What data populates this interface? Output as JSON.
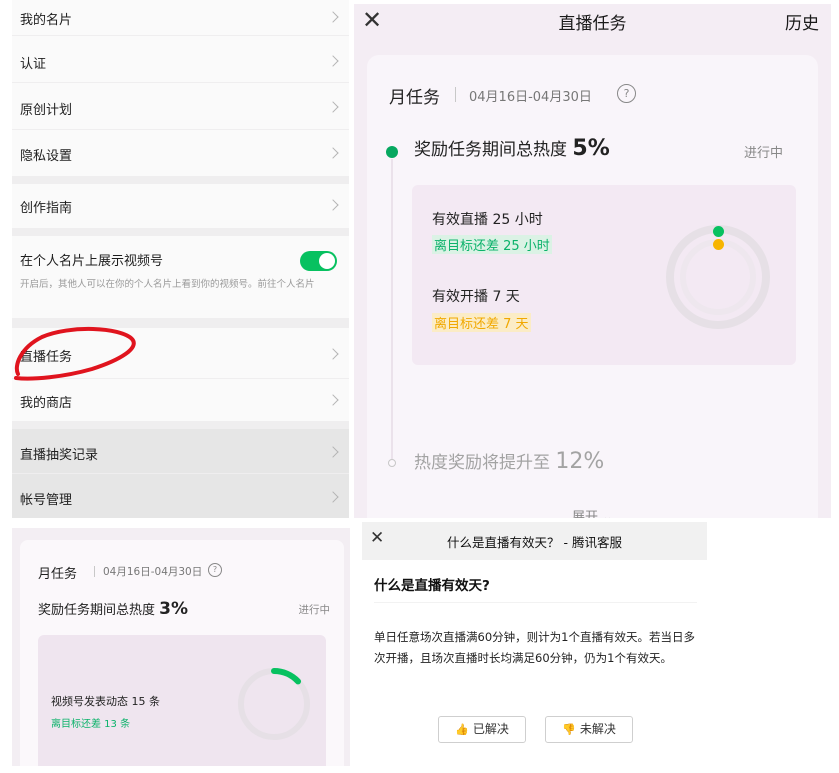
{
  "settings": {
    "items": [
      {
        "label": "我的名片"
      },
      {
        "label": "认证"
      },
      {
        "label": "原创计划"
      },
      {
        "label": "隐私设置"
      },
      {
        "label": "创作指南"
      },
      {
        "label": "在个人名片上展示视频号"
      },
      {
        "label": "直播任务"
      },
      {
        "label": "我的商店"
      },
      {
        "label": "直播抽奖记录"
      },
      {
        "label": "帐号管理"
      }
    ],
    "toggle_on": true,
    "toggle_hint": "开启后，其他人可以在你的个人名片上看到你的视频号。前往个人名片"
  },
  "live_task": {
    "title": "直播任务",
    "history": "历史",
    "monthly": "月任务",
    "date_range": "04月16日-04月30日",
    "help": "?",
    "reward_text": "奖励任务期间总热度",
    "reward_value": "5%",
    "status": "进行中",
    "tasks": [
      {
        "label": "有效直播 25 小时",
        "remain": "离目标还差 25 小时"
      },
      {
        "label": "有效开播 7 天",
        "remain": "离目标还差 7 天"
      }
    ],
    "next_text": "热度奖励将提升至",
    "next_value": "12%",
    "expand": "展开"
  },
  "task_card": {
    "monthly": "月任务",
    "date_range": "04月16日-04月30日",
    "help": "?",
    "reward_text": "奖励任务期间总热度",
    "reward_value": "3%",
    "status": "进行中",
    "task_label": "视频号发表动态 15 条",
    "task_remain": "离目标还差 13 条",
    "progress": 0.13
  },
  "help_dialog": {
    "title": "什么是直播有效天？ - 腾讯客服",
    "heading": "什么是直播有效天?",
    "body": "单日任意场次直播满60分钟，则计为1个直播有效天。若当日多次开播，且场次直播时长均满足60分钟，仍为1个有效天。",
    "resolved": "已解决",
    "unresolved": "未解决"
  },
  "colors": {
    "green": "#07c160",
    "amber": "#f7b500",
    "annotation": "#e0141e"
  }
}
